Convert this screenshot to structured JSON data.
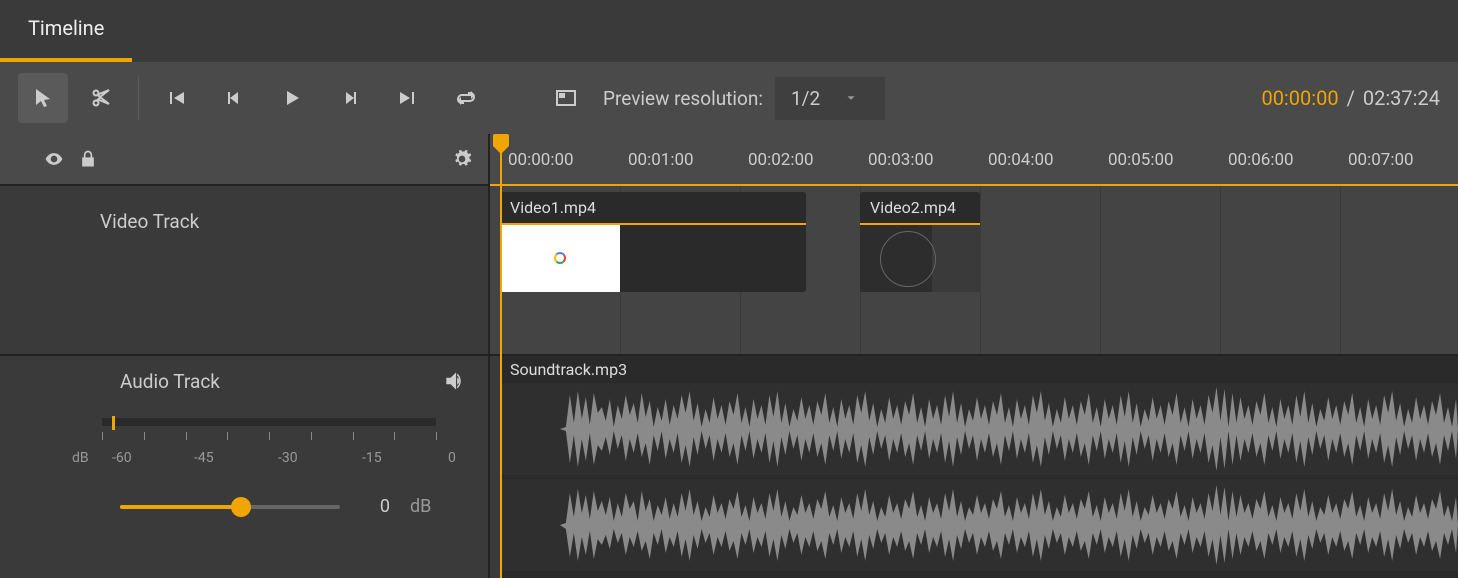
{
  "tab": {
    "label": "Timeline"
  },
  "toolbar": {
    "preview_label": "Preview resolution:",
    "preview_value": "1/2",
    "time_current": "00:00:00",
    "time_total": "02:37:24"
  },
  "ruler": {
    "ticks": [
      "00:00:00",
      "00:01:00",
      "00:02:00",
      "00:03:00",
      "00:04:00",
      "00:05:00",
      "00:06:00",
      "00:07:00"
    ]
  },
  "tracks": {
    "video": {
      "label": "Video Track"
    },
    "audio": {
      "label": "Audio Track",
      "volume_value": "0",
      "volume_unit": "dB"
    }
  },
  "db_scale": {
    "unit": "dB",
    "labels": [
      "-60",
      "-45",
      "-30",
      "-15",
      "0"
    ]
  },
  "clips": {
    "video1": {
      "name": "Video1.mp4"
    },
    "video2": {
      "name": "Video2.mp4"
    },
    "audio1": {
      "name": "Soundtrack.mp3"
    }
  }
}
